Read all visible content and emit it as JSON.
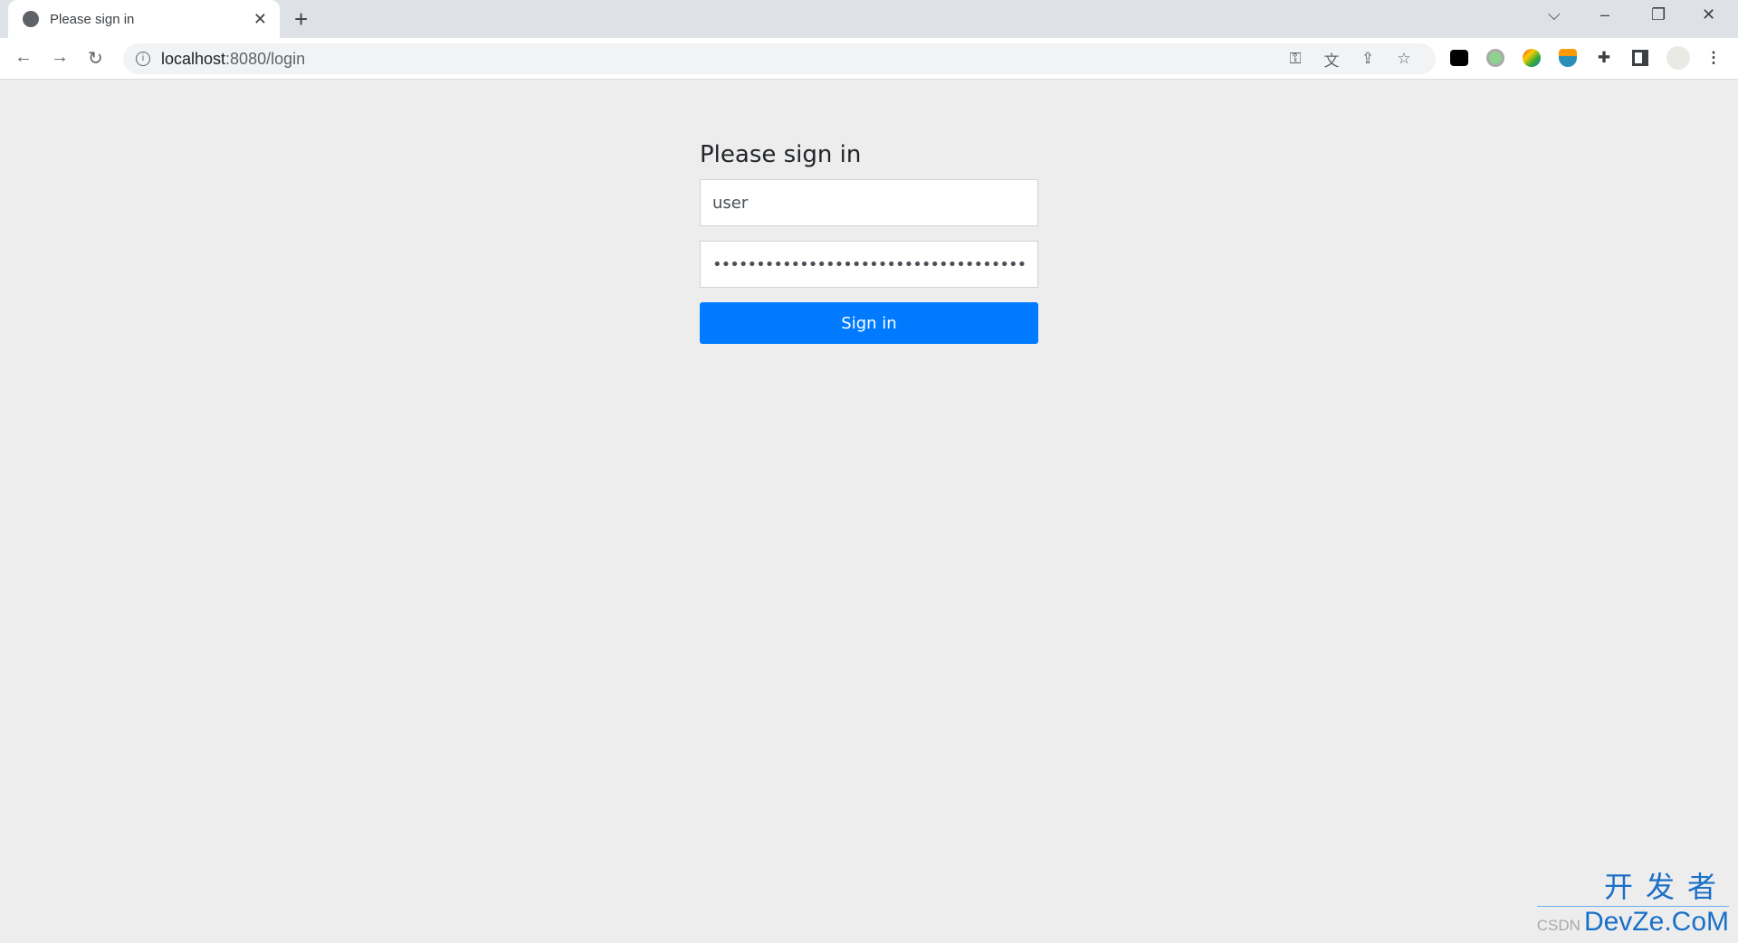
{
  "browser": {
    "tab_title": "Please sign in",
    "url_host": "localhost",
    "url_path": ":8080/login",
    "toolbar_icons": [
      "password-key-icon",
      "translate-icon",
      "share-icon",
      "bookmark-star-icon",
      "extension-tampermonkey-icon",
      "extension-green-circle-icon",
      "extension-download-manager-icon",
      "extension-bowl-icon",
      "extensions-puzzle-icon",
      "side-panel-icon",
      "profile-avatar",
      "menu-kebab-icon"
    ]
  },
  "login": {
    "heading": "Please sign in",
    "username_value": "user",
    "password_value": "••••••••••••••••••••••••••••••••••••",
    "submit_label": "Sign in"
  },
  "watermark": {
    "chinese": "开发者",
    "brand": "DevZe.CoM",
    "source": "CSDN"
  },
  "colors": {
    "primary": "#007bff",
    "page_bg": "#ededed"
  }
}
